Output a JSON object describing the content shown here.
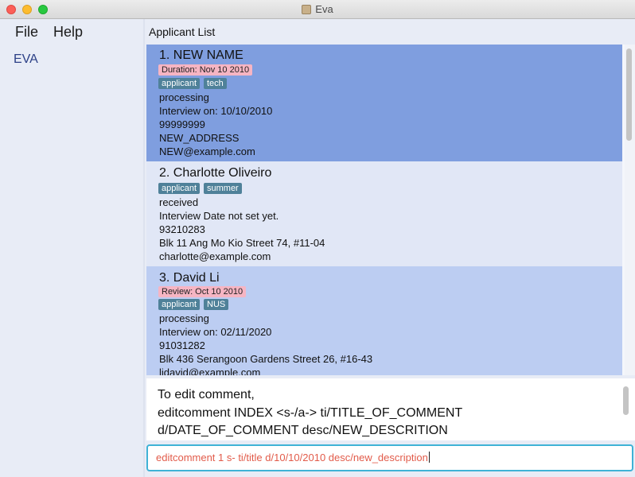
{
  "window": {
    "title": "Eva"
  },
  "menu": {
    "file": "File",
    "help": "Help"
  },
  "sidebar": {
    "label": "EVA"
  },
  "list": {
    "header": "Applicant List",
    "cards": [
      {
        "title": "1.  NEW NAME",
        "badge": "Duration: Nov 10 2010",
        "tags": [
          "applicant",
          "tech"
        ],
        "status": "processing",
        "interview": "Interview on: 10/10/2010",
        "phone": "99999999",
        "address": "NEW_ADDRESS",
        "email": "NEW@example.com"
      },
      {
        "title": "2.  Charlotte Oliveiro",
        "tags": [
          "applicant",
          "summer"
        ],
        "status": "received",
        "interview": "Interview Date not set yet.",
        "phone": "93210283",
        "address": "Blk 11 Ang Mo Kio Street 74, #11-04",
        "email": "charlotte@example.com"
      },
      {
        "title": "3.  David Li",
        "badge": "Review: Oct 10 2010",
        "tags": [
          "applicant",
          "NUS"
        ],
        "status": "processing",
        "interview": "Interview on: 02/11/2020",
        "phone": "91031282",
        "address": "Blk 436 Serangoon Gardens Street 26, #16-43",
        "email": "lidavid@example.com"
      }
    ]
  },
  "result": {
    "lines": [
      "To edit comment,",
      "editcomment INDEX <s-/a-> ti/TITLE_OF_COMMENT",
      "d/DATE_OF_COMMENT desc/NEW_DESCRITION"
    ]
  },
  "command": {
    "value": "editcomment 1 s- ti/title d/10/10/2010 desc/new_description"
  },
  "colors": {
    "selected_card": "#7f9edf",
    "card_even": "#e1e7f6",
    "card_odd": "#bccdf2",
    "tag_bg": "#4f8199",
    "badge_bg": "#f6b5c3",
    "command_text": "#e25b4a",
    "command_border": "#3fb2d6"
  }
}
